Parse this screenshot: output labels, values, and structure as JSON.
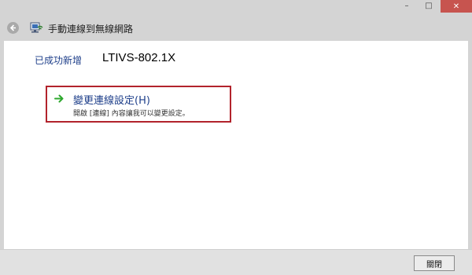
{
  "window": {
    "title": "手動連線到無線網路",
    "controls": {
      "minimize_glyph": "–",
      "maximize_glyph": "□",
      "close_glyph": "✕"
    },
    "close_color": "#c7544f"
  },
  "main": {
    "success_label": "已成功新增",
    "network_name": "LTIVS-802.1X",
    "option": {
      "title": "變更連線設定(H)",
      "description": "開啟 [連線] 內容讓我可以變更設定。",
      "icon": "green-arrow-icon",
      "highlight_color": "#b2232c"
    }
  },
  "footer": {
    "close_label": "關閉"
  }
}
